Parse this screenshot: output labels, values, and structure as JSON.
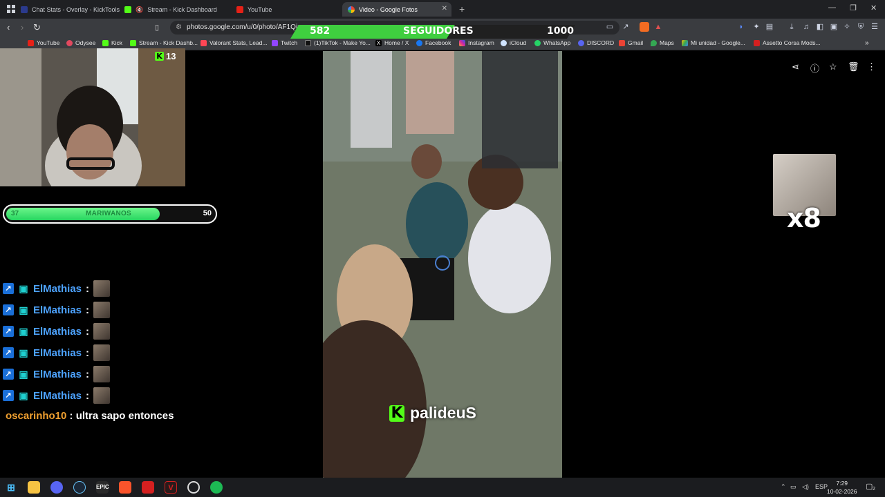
{
  "browser": {
    "tabs": [
      {
        "label": "Chat Stats - Overlay - KickTools",
        "active": false
      },
      {
        "label": "Stream - Kick Dashboard",
        "active": false
      },
      {
        "label": "YouTube",
        "active": false
      },
      {
        "label": "Video - Google Fotos",
        "active": true
      }
    ],
    "url": "photos.google.com/u/0/photo/AF1Qip",
    "bookmarks": [
      "YouTube",
      "Odysee",
      "Kick",
      "Stream - Kick Dashb...",
      "Valorant Stats, Lead...",
      "Twitch",
      "(1)TikTok - Make Yo...",
      "Home / X",
      "Facebook",
      "Instagram",
      "iCloud",
      "WhatsApp",
      "DISCORD",
      "Gmail",
      "Maps",
      "Mi unidad - Google...",
      "Assetto Corsa Mods..."
    ]
  },
  "overlay": {
    "followers_goal": {
      "current": "582",
      "label": "SEGUIDORES",
      "target": "1000",
      "progress": 0.582
    },
    "viewers": "13",
    "goal": {
      "current": "37",
      "label": "MARIWANOS",
      "max": "50",
      "progress": 0.74
    },
    "chat": [
      {
        "user": "ElMathias",
        "sep": ":"
      },
      {
        "user": "ElMathias",
        "sep": ":"
      },
      {
        "user": "ElMathias",
        "sep": ":"
      },
      {
        "user": "ElMathias",
        "sep": ":"
      },
      {
        "user": "ElMathias",
        "sep": ":"
      },
      {
        "user": "ElMathias",
        "sep": ":"
      }
    ],
    "last_message": {
      "user": "oscarinho10",
      "sep": ":",
      "text": "ultra sapo entonces"
    },
    "combo": "x8",
    "latest_follower": "palideuS",
    "kick_logo": "K"
  },
  "taskbar": {
    "language": "ESP",
    "time": "7:29",
    "date": "10-02-2026",
    "notifications": "2"
  },
  "colors": {
    "kick_green": "#53fc18",
    "tab_bg": "#1f2023",
    "toolbar_bg": "#3a3c40",
    "chat_user": "#4da3ff",
    "chat_user2": "#f0a030"
  }
}
